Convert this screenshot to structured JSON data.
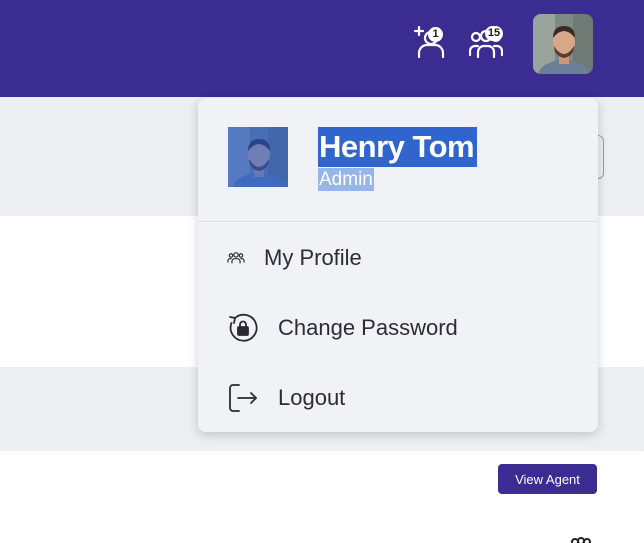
{
  "topbar": {
    "color": "#3a2c91",
    "add_user_icon": "add-user-icon",
    "add_user_count": "1",
    "team_icon": "team-icon",
    "team_count": "15",
    "avatar_alt": "Henry Tom"
  },
  "dropdown": {
    "user_name": "Henry Tom",
    "user_role": "Admin",
    "items": [
      {
        "label": "My Profile",
        "icon": "users-icon"
      },
      {
        "label": "Change Password",
        "icon": "lock-rotate-icon"
      },
      {
        "label": "Logout",
        "icon": "logout-icon"
      }
    ]
  },
  "background": {
    "view_agent_label": "View Agent"
  }
}
